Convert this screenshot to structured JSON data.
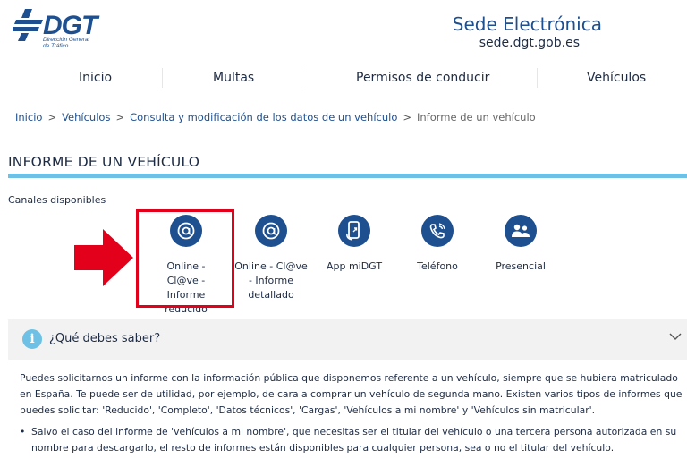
{
  "header": {
    "logo_text": "DGT",
    "logo_sub1": "Dirección General",
    "logo_sub2": "de Tráfico",
    "sede_title": "Sede Electrónica",
    "sede_url": "sede.dgt.gob.es"
  },
  "nav": {
    "items": [
      {
        "label": "Inicio"
      },
      {
        "label": "Multas"
      },
      {
        "label": "Permisos de conducir"
      },
      {
        "label": "Vehículos"
      }
    ]
  },
  "breadcrumb": {
    "items": [
      "Inicio",
      "Vehículos",
      "Consulta y modificación de los datos de un vehículo"
    ],
    "current": "Informe de un vehículo"
  },
  "page": {
    "title": "INFORME DE UN VEHÍCULO",
    "channels_label": "Canales disponibles"
  },
  "channels": [
    {
      "label": "Online - Cl@ve - Informe reducido",
      "icon": "at-icon"
    },
    {
      "label": "Online - Cl@ve - Informe detallado",
      "icon": "at-icon"
    },
    {
      "label": "App miDGT",
      "icon": "phone-app-icon"
    },
    {
      "label": "Teléfono",
      "icon": "telephone-icon"
    },
    {
      "label": "Presencial",
      "icon": "people-icon"
    }
  ],
  "accordion": {
    "title": "¿Qué debes saber?"
  },
  "content": {
    "paragraph": "Puedes solicitarnos un informe con la información pública que disponemos referente a un vehículo, siempre que se hubiera matriculado en España. Te puede ser de utilidad, por ejemplo, de cara a comprar un vehículo de segunda mano. Existen varios tipos de informes que puedes solicitar: 'Reducido', 'Completo', 'Datos técnicos', 'Cargas', 'Vehículos a mi nombre' y 'Vehículos sin matricular'.",
    "bullets": [
      "Salvo el caso del informe de 'vehículos a mi nombre', que necesitas ser el titular del vehículo o una tercera persona autorizada en su nombre para descargarlo, el resto de informes están disponibles para cualquier persona, sea o no el titular del vehículo."
    ]
  },
  "colors": {
    "brand_blue": "#1e4f8f",
    "accent_cyan": "#6ec1e4",
    "highlight_red": "#e3001b"
  }
}
